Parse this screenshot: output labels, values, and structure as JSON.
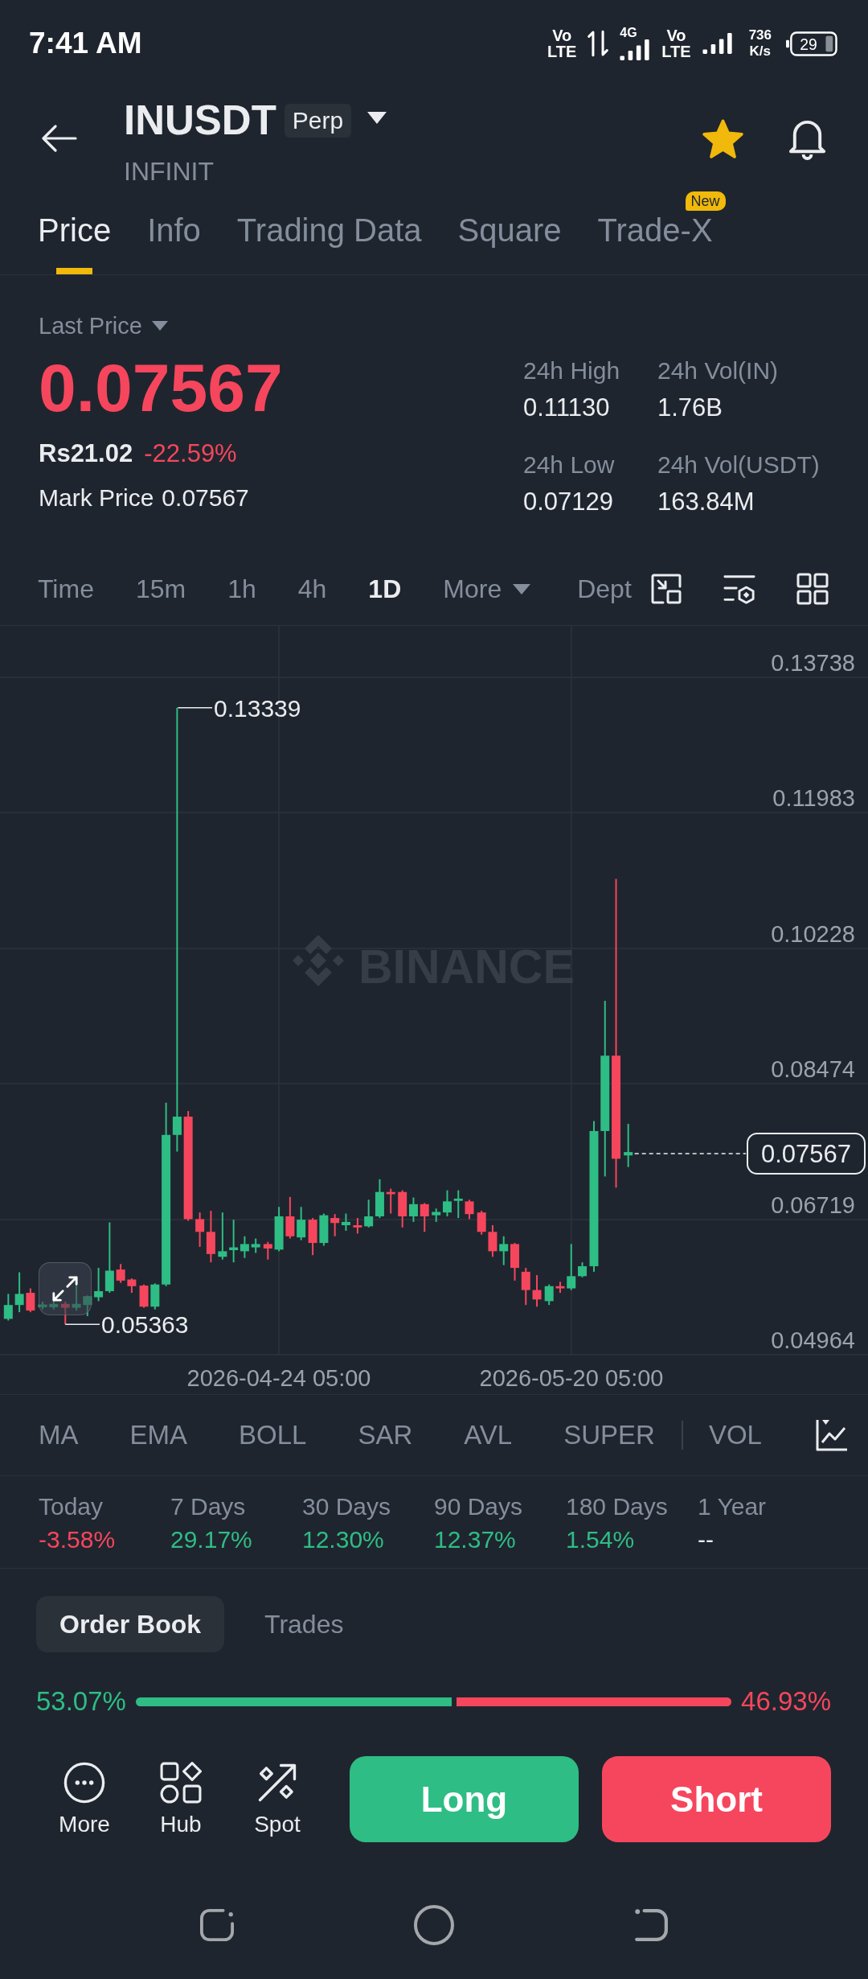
{
  "status_bar": {
    "time": "7:41 AM",
    "indicators": [
      {
        "kind": "volte",
        "lines": [
          "Vo",
          "LTE"
        ]
      },
      {
        "kind": "data_arrows"
      },
      {
        "kind": "signal",
        "label": "4G"
      },
      {
        "kind": "volte",
        "lines": [
          "Vo",
          "LTE"
        ]
      },
      {
        "kind": "signal"
      },
      {
        "kind": "speed",
        "lines": [
          "736",
          "K/s"
        ]
      }
    ],
    "battery": "29"
  },
  "header": {
    "symbol": "INUSDT",
    "badge": "Perp",
    "name": "INFINIT",
    "favorite": true
  },
  "tabs": [
    {
      "label": "Price",
      "selected": true
    },
    {
      "label": "Info",
      "selected": false
    },
    {
      "label": "Trading Data",
      "selected": false
    },
    {
      "label": "Square",
      "selected": false
    },
    {
      "label": "Trade-X",
      "selected": false,
      "badge": "New"
    }
  ],
  "price": {
    "label": "Last Price",
    "last": "0.07567",
    "falling": true,
    "fiat": "Rs21.02",
    "change": "-22.59%",
    "mark_label": "Mark Price",
    "mark": "0.07567",
    "stats": [
      {
        "label": "24h High",
        "value": "0.11130"
      },
      {
        "label": "24h Vol(IN)",
        "value": "1.76B"
      },
      {
        "label": "24h Low",
        "value": "0.07129"
      },
      {
        "label": "24h Vol(USDT)",
        "value": "163.84M"
      }
    ]
  },
  "intervals": [
    {
      "label": "Time",
      "kind": "plain",
      "selected": false
    },
    {
      "label": "15m",
      "kind": "plain",
      "selected": false
    },
    {
      "label": "1h",
      "kind": "plain",
      "selected": false
    },
    {
      "label": "4h",
      "kind": "plain",
      "selected": false
    },
    {
      "label": "1D",
      "kind": "plain",
      "selected": true
    },
    {
      "label": "More",
      "kind": "menu",
      "selected": false
    },
    {
      "label": "Dept",
      "kind": "plain",
      "selected": false
    }
  ],
  "chart": {
    "y_axis": [
      "0.13738",
      "0.11983",
      "0.10228",
      "0.08474",
      "0.06719",
      "0.04964"
    ],
    "high_label": "0.13339",
    "low_label": "0.05363",
    "last_price": "0.07567",
    "x_axis": [
      "2026-04-24 05:00",
      "2026-05-20 05:00"
    ],
    "watermark": "BINANCE"
  },
  "indicators": {
    "main": [
      "MA",
      "EMA",
      "BOLL",
      "SAR",
      "AVL",
      "SUPER"
    ],
    "sub": [
      "VOL"
    ]
  },
  "performance": [
    {
      "label": "Today",
      "value": "-3.58%",
      "color": "#f6465d"
    },
    {
      "label": "7 Days",
      "value": "29.17%",
      "color": "#2ebd85"
    },
    {
      "label": "30 Days",
      "value": "12.30%",
      "color": "#2ebd85"
    },
    {
      "label": "90 Days",
      "value": "12.37%",
      "color": "#2ebd85"
    },
    {
      "label": "180 Days",
      "value": "1.54%",
      "color": "#2ebd85"
    },
    {
      "label": "1 Year",
      "value": "--",
      "color": "#eaecef"
    }
  ],
  "book_tabs": [
    {
      "label": "Order Book",
      "selected": true
    },
    {
      "label": "Trades",
      "selected": false
    }
  ],
  "ratio": {
    "buy": "53.07%",
    "sell": "46.93%",
    "level": 0.5307
  },
  "actions": [
    {
      "kind": "more",
      "label": "More"
    },
    {
      "kind": "hub",
      "label": "Hub"
    },
    {
      "kind": "spot",
      "label": "Spot"
    }
  ],
  "trade_buttons": [
    {
      "kind": "long",
      "label": "Long"
    },
    {
      "kind": "short",
      "label": "Short"
    }
  ],
  "nav_bar": [
    {
      "kind": "recents"
    },
    {
      "kind": "home"
    },
    {
      "kind": "back"
    }
  ]
}
